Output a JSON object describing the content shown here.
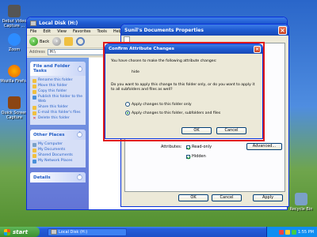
{
  "desktop": {
    "icons": [
      {
        "label": "Debut Video Capture ...",
        "color": "#555555"
      },
      {
        "label": "Zoom",
        "color": "#2d8cff"
      },
      {
        "label": "Mozilla Firefox",
        "color": "#e66000"
      },
      {
        "label": "Quick Screen Capture",
        "color": "#8b4513"
      },
      {
        "label": "Recycle Bin",
        "color": "#7aa0c8"
      }
    ]
  },
  "explorer": {
    "title": "Local Disk (H:)",
    "menu": [
      "File",
      "Edit",
      "View",
      "Favorites",
      "Tools",
      "Help"
    ],
    "back_label": "Back",
    "address_label": "Address",
    "address_value": "H:\\",
    "file_tasks": {
      "header": "File and Folder Tasks",
      "items": [
        {
          "label": "Rename this folder",
          "color": "#f0c040"
        },
        {
          "label": "Move this folder",
          "color": "#f0c040"
        },
        {
          "label": "Copy this folder",
          "color": "#f0c040"
        },
        {
          "label": "Publish this folder to the Web",
          "color": "#4a90d9"
        },
        {
          "label": "Share this folder",
          "color": "#f0c040"
        },
        {
          "label": "E-mail this folder's files",
          "color": "#f0c040"
        },
        {
          "label": "Delete this folder",
          "color": "#d22222"
        }
      ]
    },
    "other_places": {
      "header": "Other Places",
      "items": [
        {
          "label": "My Computer",
          "color": "#7aa0c8"
        },
        {
          "label": "My Documents",
          "color": "#f0c040"
        },
        {
          "label": "Shared Documents",
          "color": "#f0c040"
        },
        {
          "label": "My Network Places",
          "color": "#4a90d9"
        }
      ]
    },
    "details": {
      "header": "Details"
    }
  },
  "properties": {
    "title": "Sunil's Documents Properties",
    "attributes_label": "Attributes:",
    "read_only_label": "Read-only",
    "read_only_checked": true,
    "hidden_label": "Hidden",
    "hidden_checked": true,
    "advanced_label": "Advanced...",
    "ok_label": "OK",
    "cancel_label": "Cancel",
    "apply_label": "Apply"
  },
  "dialog": {
    "title": "Confirm Attribute Changes",
    "intro": "You have chosen to make the following attribute changes:",
    "change": "hide",
    "question": "Do you want to apply this change to this folder only, or do you want to apply it to all subfolders and files as well?",
    "option_folder_only": "Apply changes to this folder only",
    "option_all": "Apply changes to this folder, subfolders and files",
    "selected_option": "all",
    "ok_label": "OK",
    "cancel_label": "Cancel"
  },
  "taskbar": {
    "start_label": "start",
    "task_label": "Local Disk (H:)",
    "time": "1:55 PM"
  },
  "colors": {
    "highlight": "#e01a1a",
    "xp_blue": "#0831d9"
  }
}
